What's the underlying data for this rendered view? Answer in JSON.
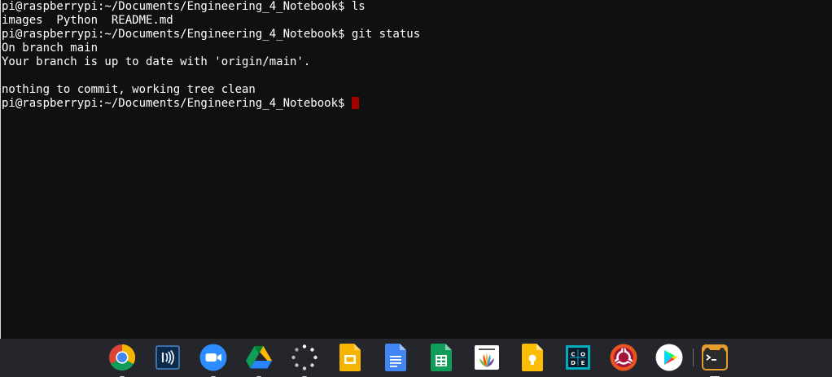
{
  "terminal": {
    "lines": [
      "pi@raspberrypi:~/Documents/Engineering_4_Notebook$ ls",
      "images  Python  README.md",
      "pi@raspberrypi:~/Documents/Engineering_4_Notebook$ git status",
      "On branch main",
      "Your branch is up to date with 'origin/main'.",
      "",
      "nothing to commit, working tree clean"
    ],
    "prompt": "pi@raspberrypi:~/Documents/Engineering_4_Notebook$ ",
    "cursor_color": "#a30000"
  },
  "shelf": {
    "apps": [
      {
        "icon": "chrome-icon",
        "running": true
      },
      {
        "icon": "nfc-tag-icon",
        "running": false
      },
      {
        "icon": "zoom-icon",
        "running": true
      },
      {
        "icon": "google-drive-icon",
        "running": true
      },
      {
        "icon": "loading-spinner-icon",
        "running": true
      },
      {
        "icon": "google-slides-icon",
        "running": false
      },
      {
        "icon": "google-docs-icon",
        "running": false
      },
      {
        "icon": "google-sheets-icon",
        "running": false
      },
      {
        "icon": "illuminate-icon",
        "running": false
      },
      {
        "icon": "google-keep-icon",
        "running": false
      },
      {
        "icon": "code-org-icon",
        "running": false
      },
      {
        "icon": "ubuntu-icon",
        "running": false
      },
      {
        "icon": "google-play-icon",
        "running": false
      },
      {
        "icon": "terminal-penguin-icon",
        "running": true
      }
    ]
  }
}
